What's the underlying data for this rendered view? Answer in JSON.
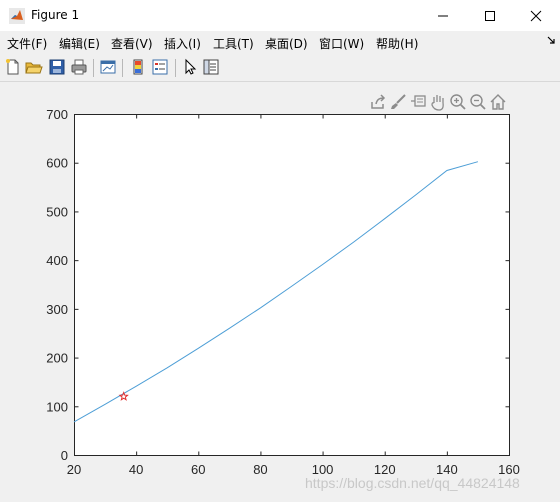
{
  "window": {
    "title": "Figure 1",
    "minimize_icon": "minimize-icon",
    "maximize_icon": "maximize-icon",
    "close_icon": "close-icon"
  },
  "menubar": {
    "items": [
      {
        "label": "文件(F)"
      },
      {
        "label": "编辑(E)"
      },
      {
        "label": "查看(V)"
      },
      {
        "label": "插入(I)"
      },
      {
        "label": "工具(T)"
      },
      {
        "label": "桌面(D)"
      },
      {
        "label": "窗口(W)"
      },
      {
        "label": "帮助(H)"
      }
    ]
  },
  "toolbar": {
    "icons": [
      "new-figure-icon",
      "open-file-icon",
      "save-icon",
      "print-icon",
      "link-plot-icon",
      "colorbar-icon",
      "legend-icon",
      "edit-plot-icon",
      "property-inspector-icon"
    ]
  },
  "axes_toolbar": {
    "icons": [
      "export-icon",
      "brush-icon",
      "data-tips-icon",
      "pan-icon",
      "zoom-in-icon",
      "zoom-out-icon",
      "home-icon"
    ]
  },
  "watermark": "https://blog.csdn.net/qq_44824148",
  "chart_data": {
    "type": "line",
    "title": "",
    "xlabel": "",
    "ylabel": "",
    "xlim": [
      20,
      160
    ],
    "ylim": [
      0,
      700
    ],
    "xticks": [
      20,
      40,
      60,
      80,
      100,
      120,
      140,
      160
    ],
    "yticks": [
      0,
      100,
      200,
      300,
      400,
      500,
      600,
      700
    ],
    "grid": false,
    "series": [
      {
        "color": "#4d9ed6",
        "x": [
          20,
          30,
          40,
          50,
          60,
          70,
          80,
          90,
          100,
          110,
          120,
          130,
          140,
          150
        ],
        "y": [
          68,
          104,
          141,
          179,
          219,
          260,
          302,
          346,
          391,
          437,
          485,
          534,
          584,
          602
        ]
      }
    ],
    "markers": [
      {
        "x": 36,
        "y": 120,
        "marker": "star",
        "color": "#e03030"
      }
    ]
  }
}
